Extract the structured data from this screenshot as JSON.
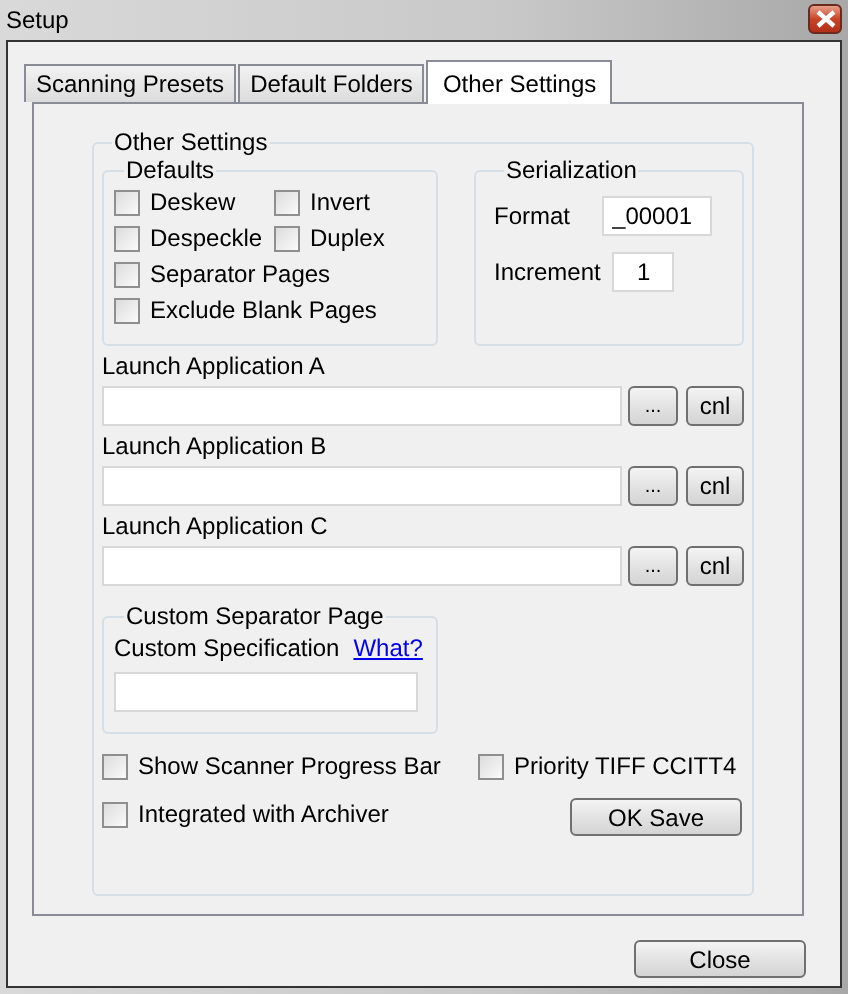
{
  "window": {
    "title": "Setup"
  },
  "tabs": [
    {
      "label": "Scanning Presets",
      "selected": false
    },
    {
      "label": "Default Folders",
      "selected": false
    },
    {
      "label": "Other Settings",
      "selected": true
    }
  ],
  "other_settings": {
    "title": "Other Settings",
    "defaults": {
      "title": "Defaults",
      "options": [
        {
          "label": "Deskew",
          "checked": false
        },
        {
          "label": "Invert",
          "checked": false
        },
        {
          "label": "Despeckle",
          "checked": false
        },
        {
          "label": "Duplex",
          "checked": false
        },
        {
          "label": "Separator Pages",
          "checked": false
        },
        {
          "label": "Exclude Blank Pages",
          "checked": false
        }
      ]
    },
    "serialization": {
      "title": "Serialization",
      "fields": [
        {
          "label": "Format",
          "value": "_00001"
        },
        {
          "label": "Increment",
          "value": "1"
        }
      ]
    },
    "launch_apps": [
      {
        "label": "Launch Application A",
        "browse": "...",
        "clear": "cnl"
      },
      {
        "label": "Launch Application B",
        "browse": "...",
        "clear": "cnl"
      },
      {
        "label": "Launch Application C",
        "browse": "...",
        "clear": "cnl"
      }
    ],
    "custom_separator": {
      "title": "Custom Separator Page",
      "label": "Custom Specification",
      "link": "What?"
    },
    "options": [
      {
        "label": "Show Scanner Progress Bar",
        "checked": false
      },
      {
        "label": "Priority TIFF CCITT4",
        "checked": false
      },
      {
        "label": "Integrated with Archiver",
        "checked": false
      }
    ],
    "ok_button": "OK Save"
  },
  "close_button": "Close"
}
